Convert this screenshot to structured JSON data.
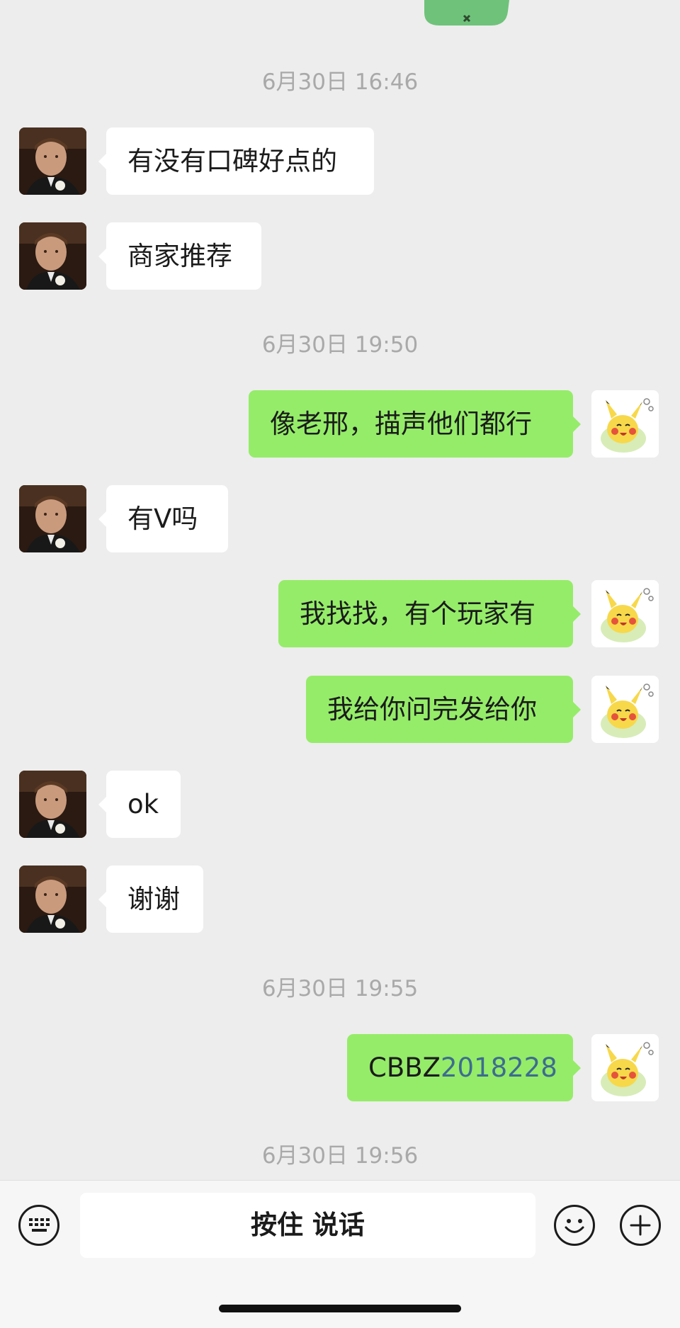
{
  "timestamps": [
    "6月30日 16:46",
    "6月30日 19:50",
    "6月30日 19:55",
    "6月30日 19:56"
  ],
  "messages": [
    {
      "from": "friend",
      "text": "有没有口碑好点的"
    },
    {
      "from": "friend",
      "text": "商家推荐"
    },
    {
      "from": "me",
      "text": "像老邢，描声他们都行"
    },
    {
      "from": "friend",
      "text": "有V吗"
    },
    {
      "from": "me",
      "text": "我找找，有个玩家有"
    },
    {
      "from": "me",
      "text": "我给你问完发给你"
    },
    {
      "from": "friend",
      "text": "ok"
    },
    {
      "from": "friend",
      "text": "谢谢"
    },
    {
      "from": "me",
      "text_prefix": "CBBZ",
      "text_number": "2018228"
    }
  ],
  "input_bar": {
    "hold_to_talk_label": "按住 说话",
    "left_icon": "keyboard-icon",
    "right_icons": [
      "emoji-icon",
      "plus-icon"
    ]
  },
  "colors": {
    "background": "#ededed",
    "incoming_bubble": "#ffffff",
    "outgoing_bubble": "#95ec69",
    "timestamp_text": "#a9a9a9",
    "link_number": "#3d6c8f"
  }
}
